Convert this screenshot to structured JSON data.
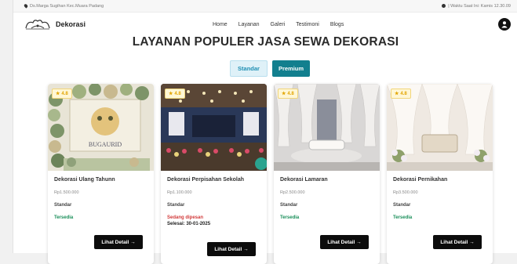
{
  "topbar": {
    "location": "Ds.Marga Sugihan Kec.Muara Padang",
    "time": "| Waktu Saat Ini: Kamis 12.30.09"
  },
  "nav": {
    "brand": "Dekorasi",
    "menu": [
      "Home",
      "Layanan",
      "Galeri",
      "Testimoni",
      "Blogs"
    ],
    "user_icon": "user-icon"
  },
  "heading": "LAYANAN POPULER JASA SEWA DEKORASI",
  "tabs": {
    "standard": "Standar",
    "premium": "Premium"
  },
  "cards": [
    {
      "rating": "4.8",
      "title": "Dekorasi Ulang Tahunn",
      "price": "Rp1.500.000",
      "type": "Standar",
      "status": "Tersedia",
      "until": "",
      "button": "Lihat Detail →"
    },
    {
      "rating": "4.8",
      "title": "Dekorasi Perpisahan Sekolah",
      "price": "Rp1.100.000",
      "type": "Standar",
      "status": "Sedang dipesan",
      "until": "Selesai: 30-01-2025",
      "button": "Lihat Detail →"
    },
    {
      "rating": "4.8",
      "title": "Dekorasi Lamaran",
      "price": "Rp2.500.000",
      "type": "Standar",
      "status": "Tersedia",
      "until": "",
      "button": "Lihat Detail →"
    },
    {
      "rating": "4.8",
      "title": "Dekorasi Pernikahan",
      "price": "Rp3.500.000",
      "type": "Standar",
      "status": "Tersedia",
      "until": "",
      "button": "Lihat Detail →"
    }
  ],
  "colors": {
    "accent": "#127f8e",
    "available": "#1a8f5a",
    "booked": "#d23b3b",
    "star": "#e2a400"
  }
}
